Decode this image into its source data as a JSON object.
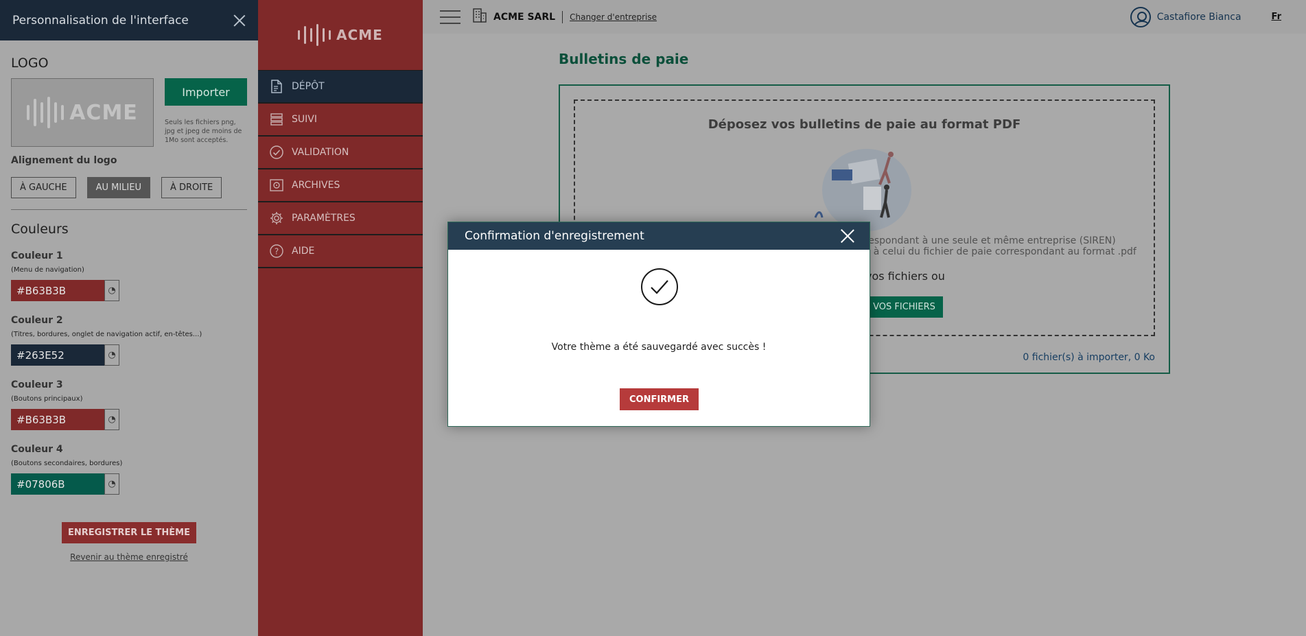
{
  "panel": {
    "title": "Personnalisation de l'interface",
    "logo_heading": "LOGO",
    "logo_text": "ACME",
    "import_label": "Importer",
    "import_hint": "Seuls les fichiers png, jpg et jpeg de moins de 1Mo sont acceptés.",
    "align_label": "Alignement du logo",
    "align_options": [
      "À GAUCHE",
      "AU MILIEU",
      "À DROITE"
    ],
    "align_selected": "AU MILIEU",
    "colors_heading": "Couleurs",
    "colors": [
      {
        "title": "Couleur 1",
        "desc": "(Menu de navigation)",
        "value": "#B63B3B",
        "swatch": "#7f2929"
      },
      {
        "title": "Couleur 2",
        "desc": "(Titres, bordures, onglet de navigation actif, en-têtes...)",
        "value": "#263E52",
        "swatch": "#1a2838"
      },
      {
        "title": "Couleur 3",
        "desc": "(Boutons principaux)",
        "value": "#B63B3B",
        "swatch": "#7f2929"
      },
      {
        "title": "Couleur 4",
        "desc": "(Boutons secondaires, bordures)",
        "value": "#07806B",
        "swatch": "#055a4b"
      }
    ],
    "save_theme_label": "ENREGISTRER LE THÈME",
    "revert_label": "Revenir au thème enregistré"
  },
  "nav": {
    "logo_text": "ACME",
    "items": [
      {
        "label": "DÉPÔT",
        "icon": "document-upload-icon",
        "active": true
      },
      {
        "label": "SUIVI",
        "icon": "list-icon",
        "active": false
      },
      {
        "label": "VALIDATION",
        "icon": "check-circle-icon",
        "active": false
      },
      {
        "label": "ARCHIVES",
        "icon": "safe-icon",
        "active": false
      },
      {
        "label": "PARAMÈTRES",
        "icon": "gear-icon",
        "active": false
      },
      {
        "label": "AIDE",
        "icon": "help-icon",
        "active": false
      }
    ]
  },
  "topbar": {
    "company_name": "ACME SARL",
    "change_company": "Changer d'entreprise",
    "user_name": "Castafiore Bianca",
    "lang": "Fr"
  },
  "main": {
    "title": "Bulletins de paie",
    "drop_title": "Déposez vos bulletins de paie au format PDF",
    "note_line1": "correspondant à une seule et même entreprise (SIREN)",
    "note_line2": "ique à celui du fichier de paie correspondant au format .pdf",
    "or_text": "vos fichiers ou",
    "browse_label": "VOS FICHIERS",
    "file_count": "0 fichier(s) à importer",
    "file_size": "0 Ko"
  },
  "modal": {
    "title": "Confirmation d'enregistrement",
    "message": "Votre thème a été sauvegardé avec succès !",
    "confirm_label": "CONFIRMER"
  },
  "colors": {
    "nav_bg": "#7f2929",
    "header_bg": "#1a2838",
    "accent_green": "#066349",
    "confirm_red": "#b63b3b"
  }
}
